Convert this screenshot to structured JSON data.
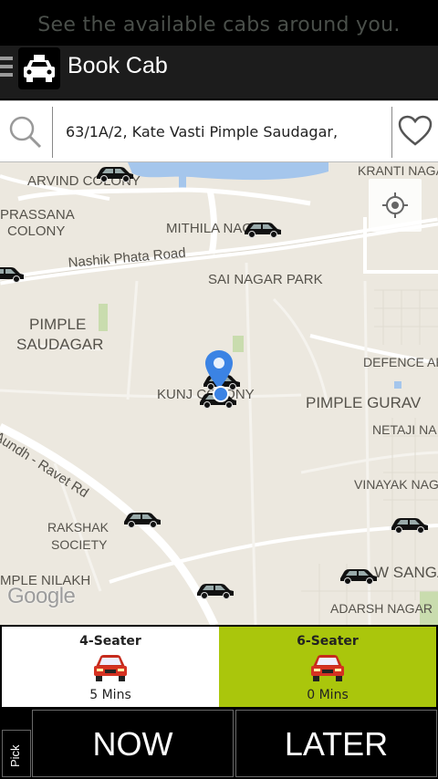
{
  "hint": "See the available cabs around you.",
  "appbar": {
    "title": "Book Cab"
  },
  "search": {
    "address": "63/1A/2, Kate Vasti Pimple Saudagar,"
  },
  "map": {
    "labels": {
      "arvind_colony": "ARVIND COLONY",
      "kranti_nagar": "KRANTI NAGA",
      "prassana": "PRASSANA",
      "colony": "COLONY",
      "mithila": "MITHILA NAGAR",
      "nashik_road": "Nashik Phata Road",
      "sai_nagar_park": "SAI NAGAR PARK",
      "pimple": "PIMPLE",
      "saudagar": "SAUDAGAR",
      "defence": "DEFENCE AR",
      "kunj_colony": "KUNJ COLONY",
      "pimple_gurav": "PIMPLE GURAV",
      "netaji": "NETAJI NA",
      "aundh_ravet": "Aundh - Ravet Rd",
      "vinayak": "VINAYAK NAG",
      "rakshak": "RAKSHAK",
      "society": "SOCIETY",
      "new_sangavi": "W SANGA",
      "pimple_nilakh": "MPLE NILAKH",
      "adarsh_nagar": "ADARSH NAGAR",
      "google": "Google"
    }
  },
  "seats": [
    {
      "name": "4-Seater",
      "eta": "5 Mins",
      "selected": false
    },
    {
      "name": "6-Seater",
      "eta": "0 Mins",
      "selected": true
    }
  ],
  "bottom": {
    "pick_label": "Pick",
    "now_label": "NOW",
    "later_label": "LATER"
  },
  "colors": {
    "accent": "#aac60c",
    "appbar": "#1c1c1c",
    "map_bg": "#ece8df",
    "location_dot": "#3b83e4"
  },
  "icons": [
    "menu-icon",
    "taxi-icon",
    "search-icon",
    "heart-icon",
    "my-location-icon",
    "car-icon",
    "location-pin-icon"
  ]
}
